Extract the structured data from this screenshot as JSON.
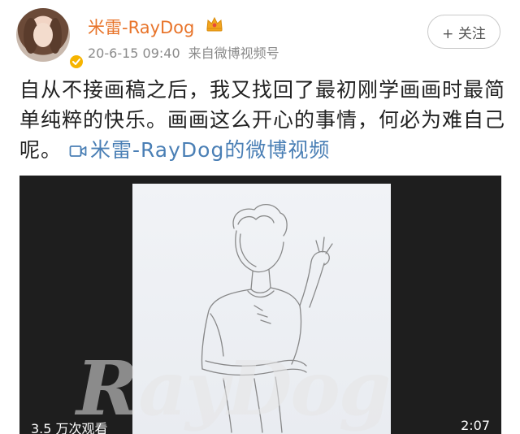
{
  "post": {
    "author": {
      "name": "米雷-RayDog"
    },
    "meta": {
      "time": "20-6-15 09:40",
      "source": "来自微博视频号"
    },
    "follow_label": "+ 关注",
    "text": "自从不接画稿之后，我又找回了最初刚学画画时最简单纯粹的快乐。画画这么开心的事情，何必为难自己呢。",
    "video_link_label": "米雷-RayDog的微博视频"
  },
  "video": {
    "views": "3.5 万次观看",
    "duration": "2:07",
    "watermark": "RayDog"
  },
  "colors": {
    "username": "#e8742a",
    "link": "#4a7fb5",
    "meta": "#8a8a8a",
    "verified_badge": "#f6b400",
    "video_bg": "#1e1e1e"
  },
  "icons": [
    "verified-badge-icon",
    "crown-icon",
    "video-icon"
  ]
}
